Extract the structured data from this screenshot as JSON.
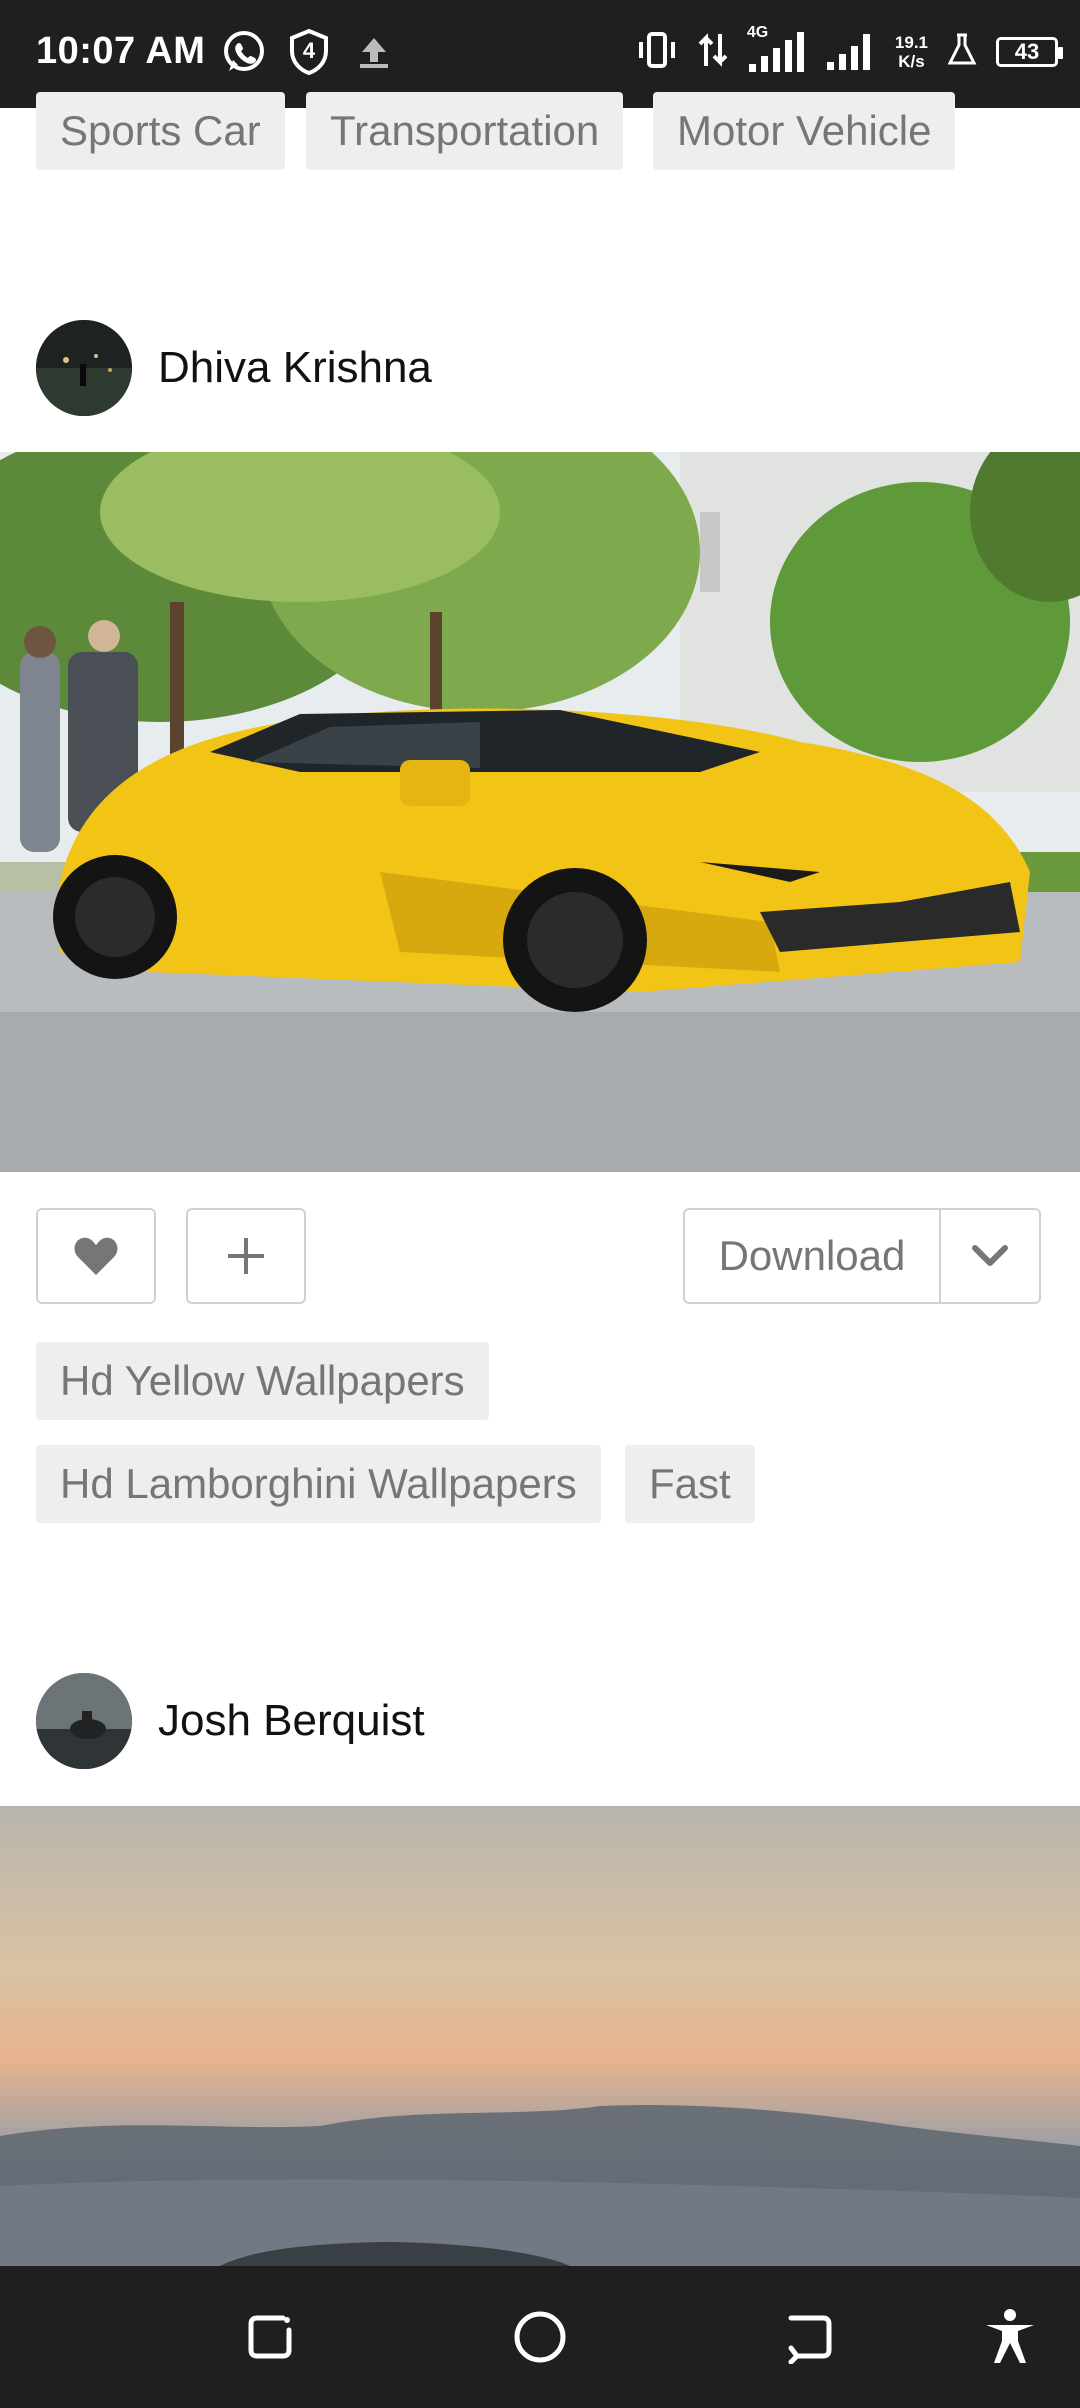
{
  "status_bar": {
    "time": "10:07 AM",
    "network_type": "4G",
    "speed_value": "19.1",
    "speed_unit": "K/s",
    "battery": "43",
    "shield_number": "4"
  },
  "post1_tags": [
    "Sports Car",
    "Transportation",
    "Motor Vehicle"
  ],
  "post2": {
    "author": "Dhiva Krishna",
    "download_label": "Download",
    "tags_row1": [
      "Hd Yellow Wallpapers"
    ],
    "tags_row2": [
      "Hd Lamborghini Wallpapers",
      "Fast"
    ],
    "car_color": "#f2c416"
  },
  "post3": {
    "author": "Josh Berquist"
  },
  "colors": {
    "tag_bg": "#eeeeee",
    "tag_text": "#767676",
    "bar_bg": "#1f1f1f"
  }
}
